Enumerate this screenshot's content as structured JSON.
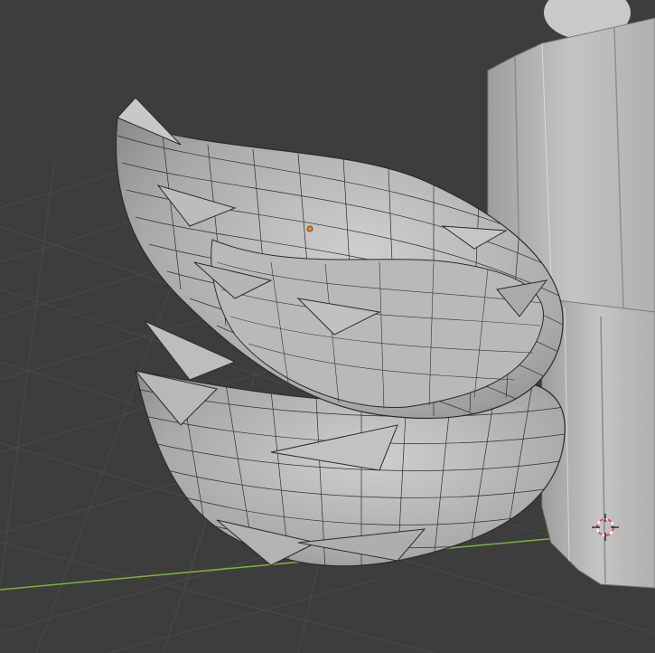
{
  "viewport": {
    "background_color": "#3d3d3d",
    "grid_line_color": "#4a4a4a",
    "x_axis_color": "#7fb23a",
    "mesh_face_color": "#a8a8a8",
    "mesh_highlight_color": "#cfcfcf",
    "mesh_wire_color": "#2b2b2b",
    "character_color": "#bdbdbd",
    "origin_dot_color": "#e88a22"
  },
  "objects": [
    {
      "name": "wing-mesh",
      "kind": "selected-edit-mesh"
    },
    {
      "name": "character-body",
      "kind": "mesh"
    },
    {
      "name": "3d-cursor",
      "kind": "cursor"
    }
  ]
}
